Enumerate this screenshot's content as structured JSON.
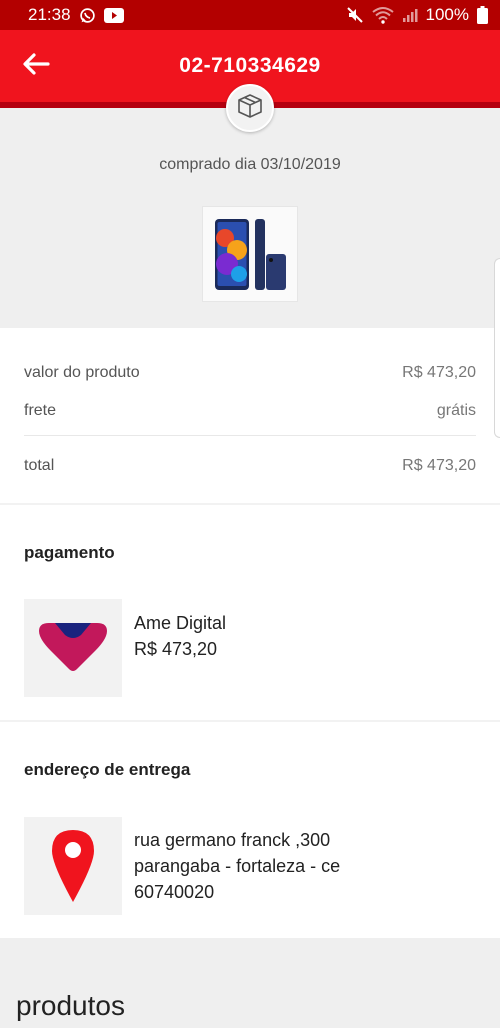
{
  "status_bar": {
    "time": "21:38",
    "battery": "100%",
    "left_icons": [
      "whatsapp-icon",
      "youtube-icon"
    ],
    "right_icons": [
      "mute-icon",
      "wifi-icon",
      "signal-icon",
      "battery-icon"
    ]
  },
  "app_bar": {
    "title": "02-710334629",
    "back_icon": "arrow-left-icon"
  },
  "order": {
    "purchase_date": "comprado dia 03/10/2019",
    "product_image": "phone-image"
  },
  "summary": {
    "product_value_label": "valor do produto",
    "product_value": "R$ 473,20",
    "shipping_label": "frete",
    "shipping_value": "grátis",
    "total_label": "total",
    "total_value": "R$ 473,20"
  },
  "payment": {
    "title": "pagamento",
    "method": "Ame Digital",
    "amount": "R$ 473,20",
    "icon": "ame-digital-logo"
  },
  "delivery": {
    "title": "endereço de entrega",
    "address_line1": "rua germano franck ,300",
    "address_line2": "parangaba - fortaleza - ce",
    "zip": "60740020",
    "icon": "location-pin-icon"
  },
  "products": {
    "title": "produtos"
  },
  "colors": {
    "brand_red": "#f0141e",
    "status_bar": "#b30000",
    "ame_pink": "#c2185b",
    "ame_navy": "#1a237e"
  }
}
